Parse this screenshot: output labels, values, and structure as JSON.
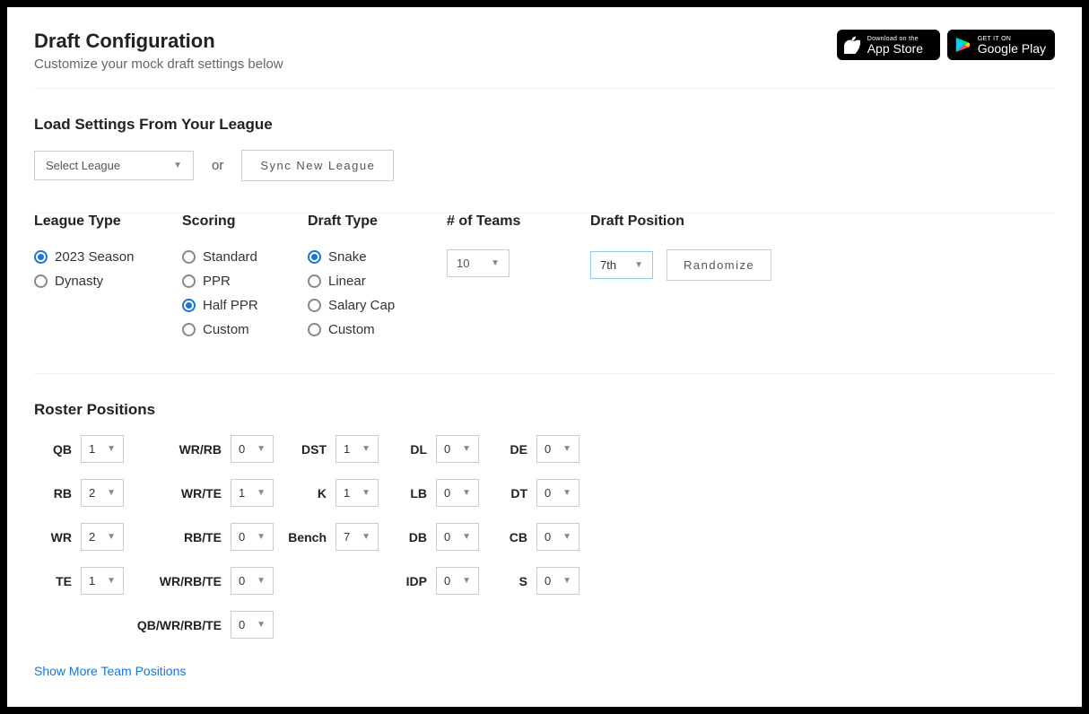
{
  "header": {
    "title": "Draft Configuration",
    "subtitle": "Customize your mock draft settings below",
    "app_store_small": "Download on the",
    "app_store_large": "App Store",
    "google_play_small": "GET IT ON",
    "google_play_large": "Google Play"
  },
  "load": {
    "heading": "Load Settings From Your League",
    "select_placeholder": "Select League",
    "or": "or",
    "sync_button": "Sync New League"
  },
  "config": {
    "league_type": {
      "heading": "League Type",
      "options": [
        "2023 Season",
        "Dynasty"
      ],
      "selected": "2023 Season"
    },
    "scoring": {
      "heading": "Scoring",
      "options": [
        "Standard",
        "PPR",
        "Half PPR",
        "Custom"
      ],
      "selected": "Half PPR"
    },
    "draft_type": {
      "heading": "Draft Type",
      "options": [
        "Snake",
        "Linear",
        "Salary Cap",
        "Custom"
      ],
      "selected": "Snake"
    },
    "num_teams": {
      "heading": "# of Teams",
      "value": "10"
    },
    "draft_position": {
      "heading": "Draft Position",
      "value": "7th",
      "button": "Randomize"
    }
  },
  "roster": {
    "heading": "Roster Positions",
    "show_more": "Show More Team Positions",
    "cols": [
      [
        {
          "label": "QB",
          "value": "1"
        },
        {
          "label": "RB",
          "value": "2"
        },
        {
          "label": "WR",
          "value": "2"
        },
        {
          "label": "TE",
          "value": "1"
        }
      ],
      [
        {
          "label": "WR/RB",
          "value": "0"
        },
        {
          "label": "WR/TE",
          "value": "1"
        },
        {
          "label": "RB/TE",
          "value": "0"
        },
        {
          "label": "WR/RB/TE",
          "value": "0"
        },
        {
          "label": "QB/WR/RB/TE",
          "value": "0"
        }
      ],
      [
        {
          "label": "DST",
          "value": "1"
        },
        {
          "label": "K",
          "value": "1"
        },
        {
          "label": "Bench",
          "value": "7"
        }
      ],
      [
        {
          "label": "DL",
          "value": "0"
        },
        {
          "label": "LB",
          "value": "0"
        },
        {
          "label": "DB",
          "value": "0"
        },
        {
          "label": "IDP",
          "value": "0"
        }
      ],
      [
        {
          "label": "DE",
          "value": "0"
        },
        {
          "label": "DT",
          "value": "0"
        },
        {
          "label": "CB",
          "value": "0"
        },
        {
          "label": "S",
          "value": "0"
        }
      ]
    ]
  }
}
